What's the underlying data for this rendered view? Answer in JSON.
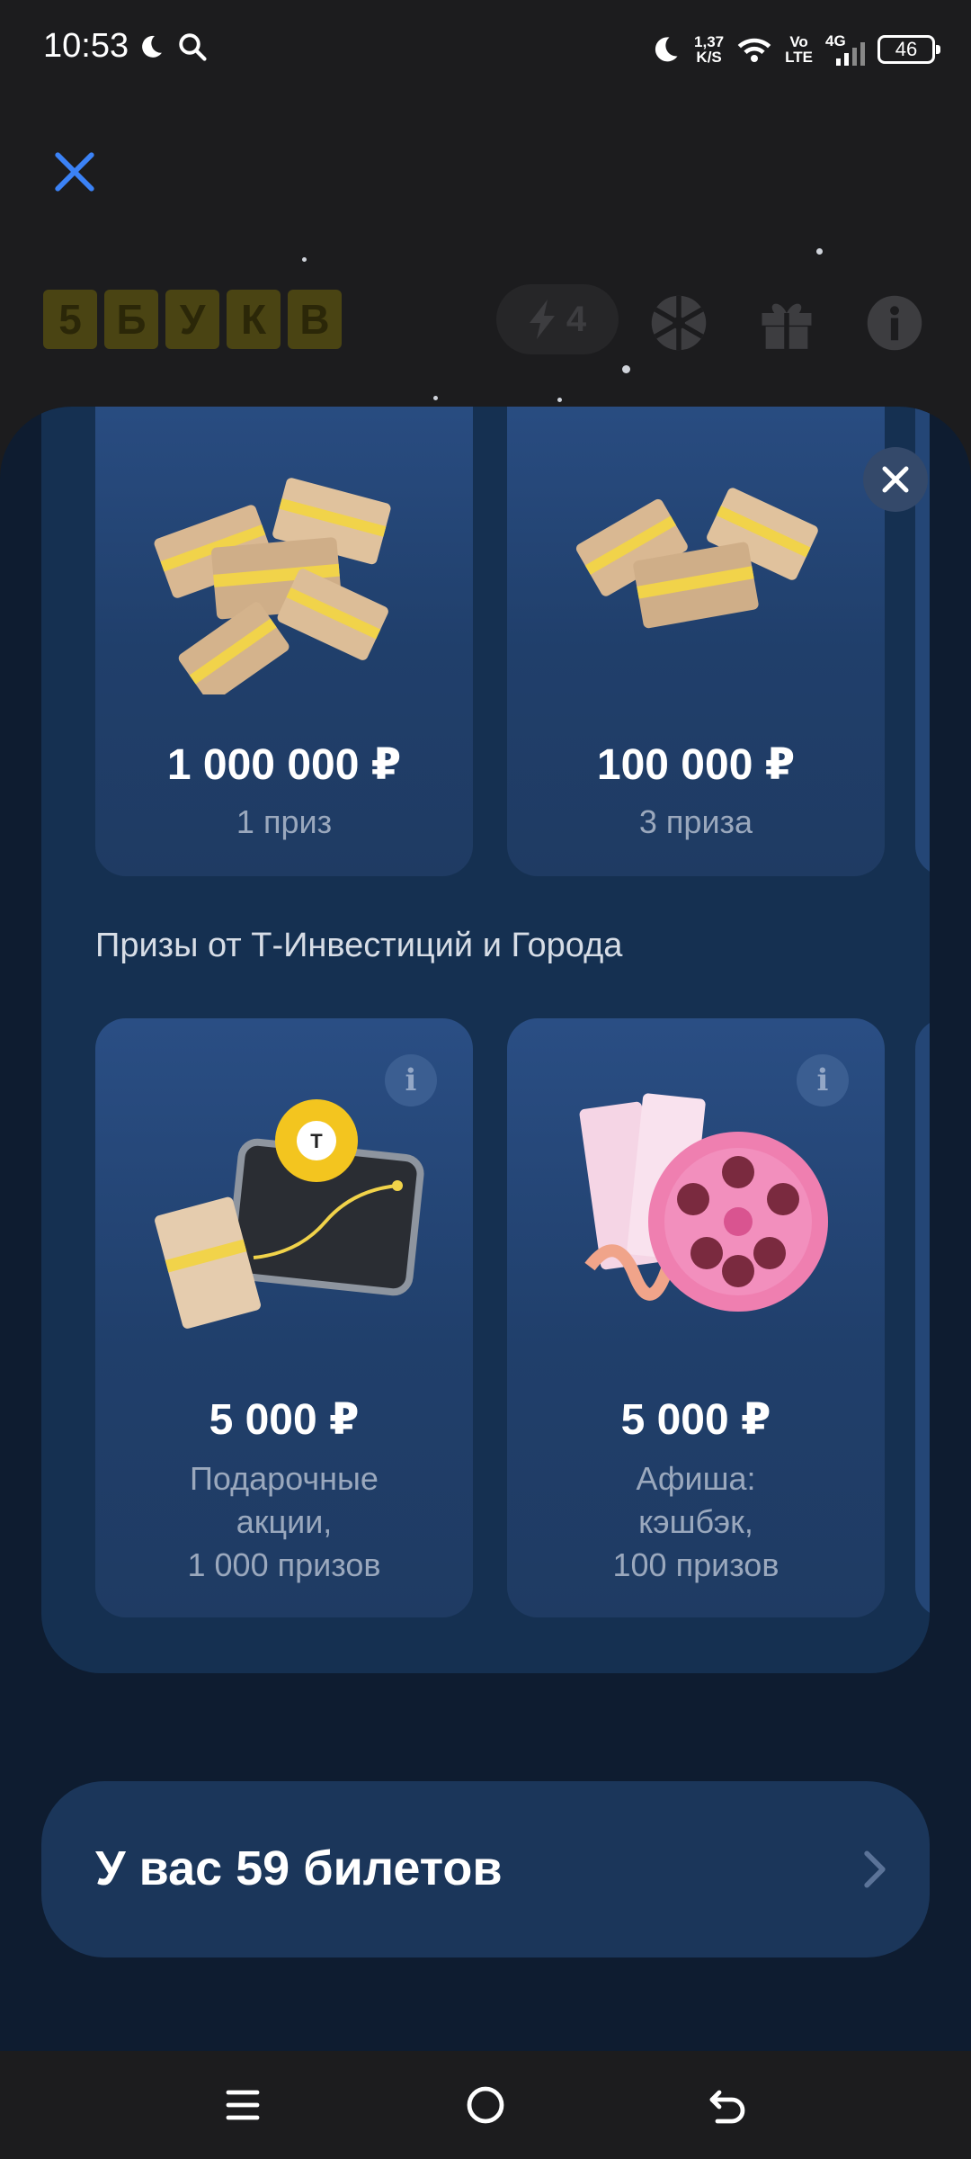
{
  "status_bar": {
    "time": "10:53",
    "speed_value": "1,37",
    "speed_unit": "K/S",
    "volte_top": "Vo",
    "volte_bottom": "LTE",
    "network": "4G",
    "battery": "46"
  },
  "header": {
    "logo_letters": [
      "5",
      "Б",
      "У",
      "К",
      "В"
    ],
    "energy_count": "4"
  },
  "top_prizes": [
    {
      "amount": "1 000 000 ₽",
      "caption": "1 приз"
    },
    {
      "amount": "100 000 ₽",
      "caption": "3 приза"
    }
  ],
  "partner_section": {
    "title": "Призы от Т-Инвестиций и Города",
    "prizes": [
      {
        "amount": "5 000 ₽",
        "line1": "Подарочные",
        "line2": "акции,",
        "line3": "1 000 призов"
      },
      {
        "amount": "5 000 ₽",
        "line1": "Афиша:",
        "line2": "кэшбэк,",
        "line3": "100 призов"
      }
    ],
    "info_glyph": "i"
  },
  "tickets_button": {
    "label": "У вас 59 билетов"
  },
  "colors": {
    "accent_blue": "#3b82f6",
    "logo_yellow": "#4a4413",
    "sheet_bg": "#0e1c30",
    "card_bg": "#2a4e84"
  }
}
